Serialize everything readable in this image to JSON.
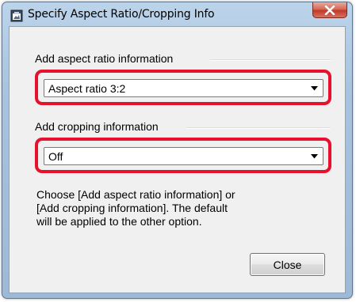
{
  "window": {
    "title": "Specify Aspect Ratio/Cropping Info",
    "close_icon": "close-icon",
    "app_icon": "crop-app-icon"
  },
  "aspect_group": {
    "label": "Add aspect ratio information",
    "selected": "Aspect ratio 3:2"
  },
  "cropping_group": {
    "label": "Add cropping information",
    "selected": "Off"
  },
  "help": {
    "lines": [
      "Choose [Add aspect ratio information] or",
      "[Add cropping information]. The default",
      "will be applied to the other option."
    ]
  },
  "buttons": {
    "close_label": "Close"
  },
  "colors": {
    "highlight": "#e8112d",
    "titlebar": "#a9c3de",
    "dialog_bg": "#f0f0f0"
  }
}
